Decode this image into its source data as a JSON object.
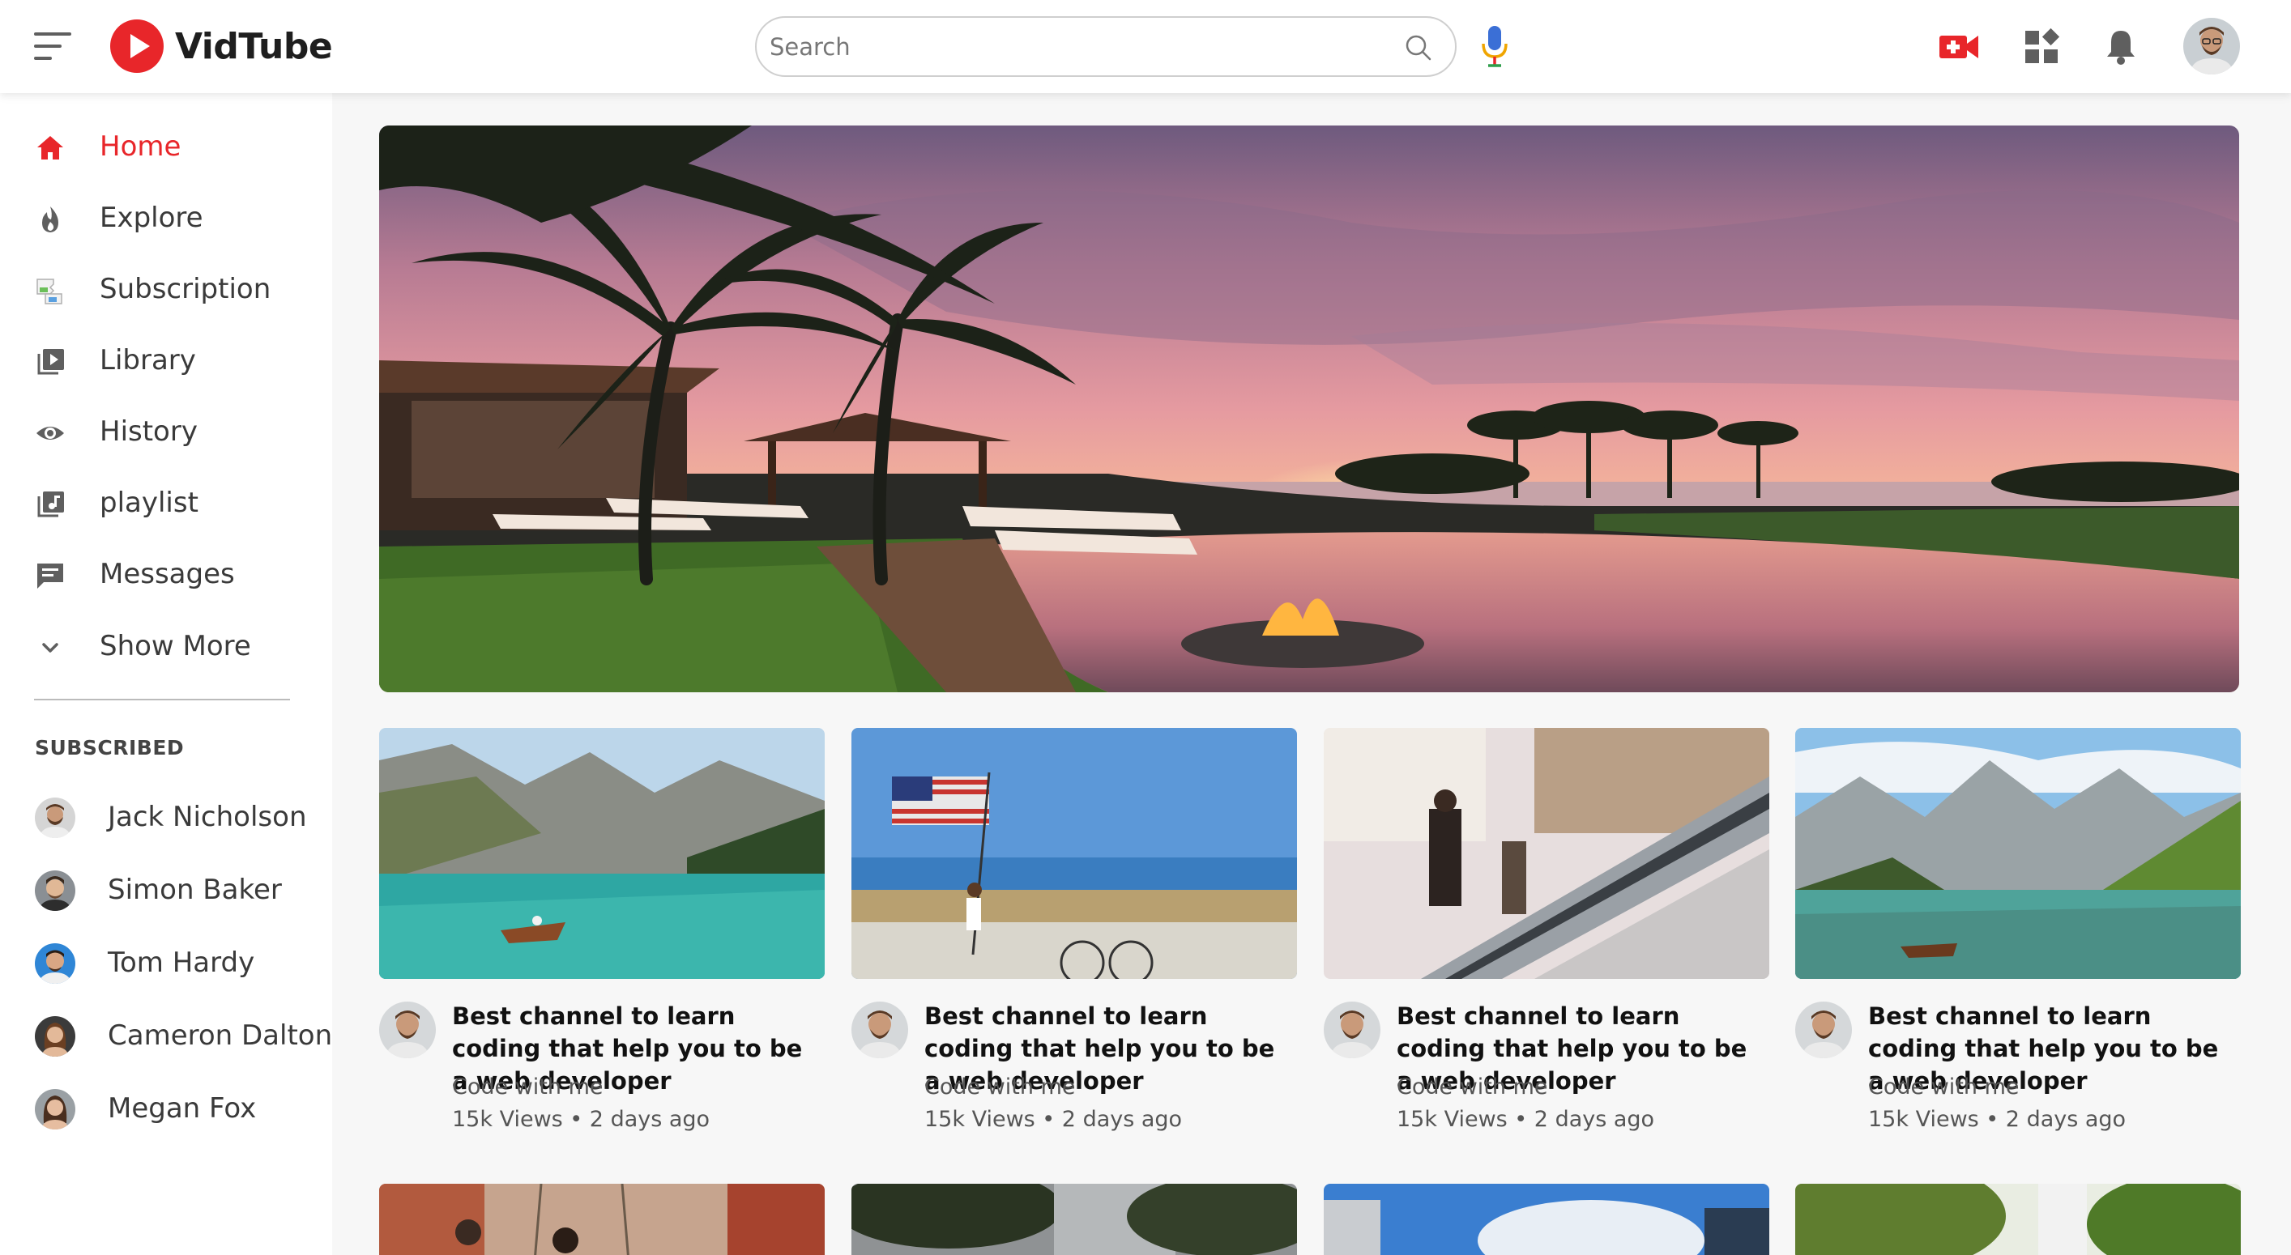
{
  "app": {
    "name": "VidTube"
  },
  "search": {
    "placeholder": "Search"
  },
  "colors": {
    "accent": "#e8262a",
    "text": "#3a3a3a",
    "sidebar_bg": "#ffffff",
    "main_bg": "#f7f7f7"
  },
  "header_icons": [
    "menu-icon",
    "search-icon",
    "mic-icon",
    "upload-video-icon",
    "apps-icon",
    "bell-icon",
    "user-avatar"
  ],
  "sidebar": {
    "items": [
      {
        "label": "Home",
        "icon": "home-icon",
        "active": true
      },
      {
        "label": "Explore",
        "icon": "flame-icon"
      },
      {
        "label": "Subscription",
        "icon": "broken-image-icon"
      },
      {
        "label": "Library",
        "icon": "library-icon"
      },
      {
        "label": "History",
        "icon": "eye-icon"
      },
      {
        "label": "playlist",
        "icon": "playlist-icon"
      },
      {
        "label": "Messages",
        "icon": "message-icon"
      },
      {
        "label": "Show More",
        "icon": "chevron-down-icon"
      }
    ],
    "subscribed_heading": "SUBSCRIBED",
    "subscriptions": [
      {
        "name": "Jack Nicholson"
      },
      {
        "name": "Simon Baker"
      },
      {
        "name": "Tom Hardy"
      },
      {
        "name": "Cameron Dalton"
      },
      {
        "name": "Megan Fox"
      }
    ]
  },
  "videos": [
    {
      "title": "Best channel to learn coding that help you to be a web developer",
      "channel": "Code with me",
      "meta": "15k Views • 2 days ago"
    },
    {
      "title": "Best channel to learn coding that help you to be a web developer",
      "channel": "Code with me",
      "meta": "15k Views • 2 days ago"
    },
    {
      "title": "Best channel to learn coding that help you to be a web developer",
      "channel": "Code with me",
      "meta": "15k Views • 2 days ago"
    },
    {
      "title": "Best channel to learn coding that help you to be a web developer",
      "channel": "Code with me",
      "meta": "15k Views • 2 days ago"
    }
  ]
}
